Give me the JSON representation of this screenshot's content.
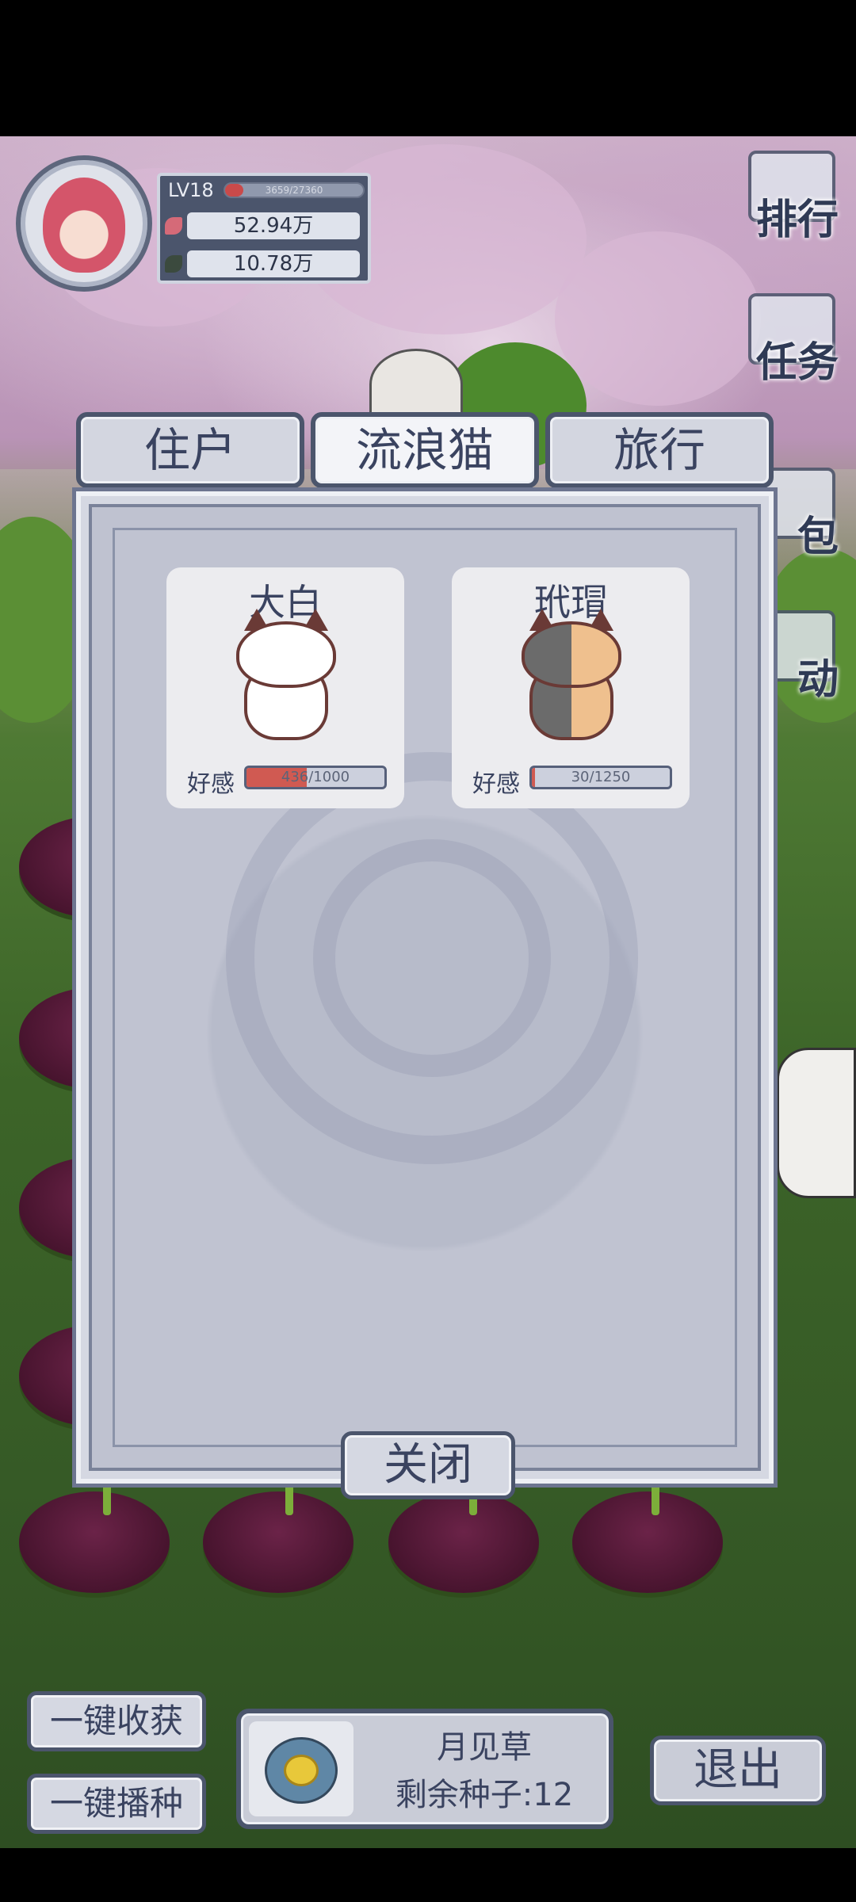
{
  "player": {
    "level": "LV18",
    "exp_text": "3659/27360",
    "exp_fraction": 0.13,
    "resource_1": "52.94万",
    "resource_2": "10.78万"
  },
  "side_menu": [
    {
      "label": "排行",
      "icon": "ranking-icon"
    },
    {
      "label": "任务",
      "icon": "task-icon"
    },
    {
      "label": "包",
      "icon": "bag-icon"
    },
    {
      "label": "动",
      "icon": "activity-icon"
    }
  ],
  "tabs": [
    {
      "label": "住户",
      "active": false
    },
    {
      "label": "流浪猫",
      "active": true
    },
    {
      "label": "旅行",
      "active": false
    }
  ],
  "cats": [
    {
      "name": "大白",
      "affection_label": "好感",
      "affection_text": "436/1000",
      "affection_fraction": 0.436,
      "colors": {
        "body": "#ffffff"
      }
    },
    {
      "name": "玳瑁",
      "affection_label": "好感",
      "affection_text": "30/1250",
      "affection_fraction": 0.024,
      "colors": {
        "left": "#6b6b6b",
        "right": "#efc08e"
      }
    }
  ],
  "close_label": "关闭",
  "bottom": {
    "harvest_label": "一键收获",
    "sow_label": "一键播种",
    "seed_name": "月见草",
    "seed_count": "剩余种子:12",
    "exit_label": "退出"
  }
}
